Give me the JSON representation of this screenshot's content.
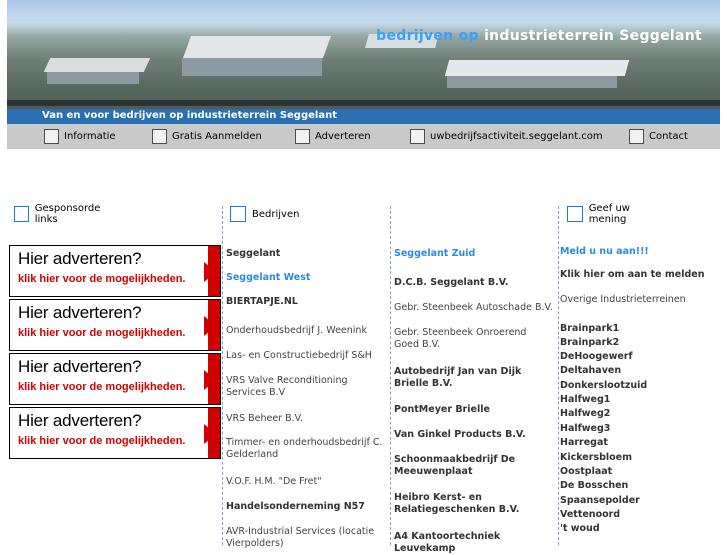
{
  "banner": {
    "title_highlight": "bedrijven op",
    "title_rest": "industrieterrein Seggelant",
    "tagline": "Van en voor bedrijven op industrieterrein Seggelant"
  },
  "nav": [
    {
      "label": "Informatie"
    },
    {
      "label": "Gratis Aanmelden"
    },
    {
      "label": "Adverteren"
    },
    {
      "label": "uwbedrijfsactiviteit.seggelant.com"
    },
    {
      "label": "Contact"
    }
  ],
  "sections": {
    "sponsored": "Gesponsorde links",
    "companies": "Bedrijven",
    "opinion": "Geef uw mening"
  },
  "ads": [
    {
      "line1": "Hier adverteren?",
      "line2": "klik hier voor de mogelijkheden."
    },
    {
      "line1": "Hier adverteren?",
      "line2": "klik hier voor de mogelijkheden."
    },
    {
      "line1": "Hier adverteren?",
      "line2": "klik hier voor de mogelijkheden."
    },
    {
      "line1": "Hier adverteren?",
      "line2": "klik hier voor de mogelijkheden."
    }
  ],
  "companies_col1": [
    "Seggelant",
    "Seggelant West",
    "BIERTAPJE.NL",
    "Onderhoudsbedrijf J. Weenink",
    "Las- en Constructiebedrijf S&H",
    "VRS Valve Reconditioning Services B.V",
    "VRS Beheer B.V.",
    "Timmer- en onderhoudsbedrijf C. Gelderland",
    "V.O.F. H.M. \"De Fret\"",
    "Handelsonderneming N57",
    "AVR-Industrial Services (locatie Vierpolders)"
  ],
  "companies_col2": [
    "Seggelant Zuid",
    "D.C.B. Seggelant B.V.",
    "Gebr. Steenbeek Autoschade B.V.",
    "Gebr. Steenbeek Onroerend Goed B.V.",
    "Autobedrijf Jan van Dijk Brielle B.V.",
    "PontMeyer Brielle",
    "Van Ginkel Products B.V.",
    "Schoonmaakbedrijf De Meeuwenplaat",
    "Heibro Kerst- en Relatiegeschenken B.V.",
    "A4 Kantoortechniek Leuvekamp"
  ],
  "opinion": {
    "signup": "Meld u nu aan!!!",
    "signup_cta": "Klik hier om aan te melden",
    "other": "Overige Industrieterreinen",
    "terrains": [
      "Brainpark1",
      "Brainpark2",
      "DeHoogewerf",
      "Deltahaven",
      "Donkerslootzuid",
      "Halfweg1",
      "Halfweg2",
      "Halfweg3",
      "Harregat",
      "Kickersbloem",
      "Oostplaat",
      "De Bosschen",
      "Spaansepolder",
      "Vettenoord",
      "'t woud"
    ]
  }
}
